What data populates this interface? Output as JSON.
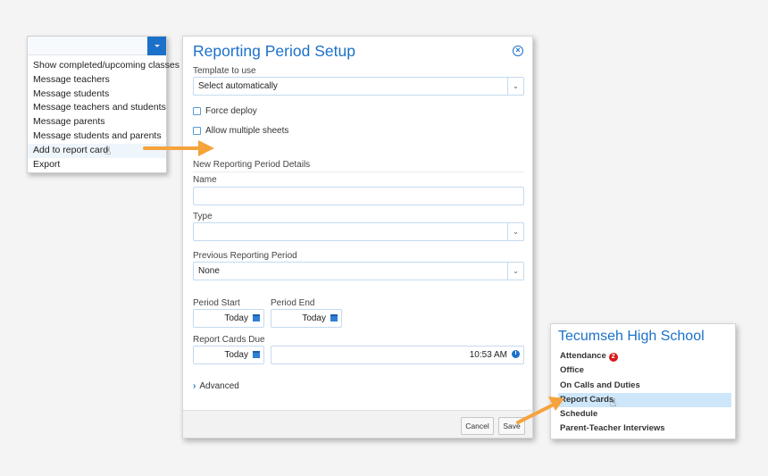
{
  "dropdown": {
    "items": [
      "Show completed/upcoming classes",
      "Message teachers",
      "Message students",
      "Message teachers and students",
      "Message parents",
      "Message students and parents",
      "Add to report card",
      "Export"
    ],
    "highlighted_index": 6
  },
  "dialog": {
    "title": "Reporting Period Setup",
    "template_label": "Template to use",
    "template_value": "Select automatically",
    "force_deploy_label": "Force deploy",
    "allow_multiple_label": "Allow multiple sheets",
    "section_title": "New Reporting Period Details",
    "name_label": "Name",
    "name_value": "",
    "type_label": "Type",
    "type_value": "",
    "previous_label": "Previous Reporting Period",
    "previous_value": "None",
    "period_start_label": "Period Start",
    "period_start_value": "Today",
    "period_end_label": "Period End",
    "period_end_value": "Today",
    "due_label": "Report Cards Due",
    "due_date_value": "Today",
    "due_time_value": "10:53 AM",
    "advanced_label": "Advanced",
    "cancel_label": "Cancel",
    "save_label": "Save"
  },
  "school_panel": {
    "title": "Tecumseh High School",
    "items": [
      {
        "label": "Attendance",
        "badge": "2"
      },
      {
        "label": "Office"
      },
      {
        "label": "On Calls and Duties"
      },
      {
        "label": "Report Cards"
      },
      {
        "label": "Schedule"
      },
      {
        "label": "Parent-Teacher Interviews"
      }
    ],
    "highlighted_index": 3
  },
  "colors": {
    "accent": "#1b71c9",
    "arrow": "#f5a33b",
    "highlight": "#cde6fa",
    "badge": "#d7191c"
  }
}
